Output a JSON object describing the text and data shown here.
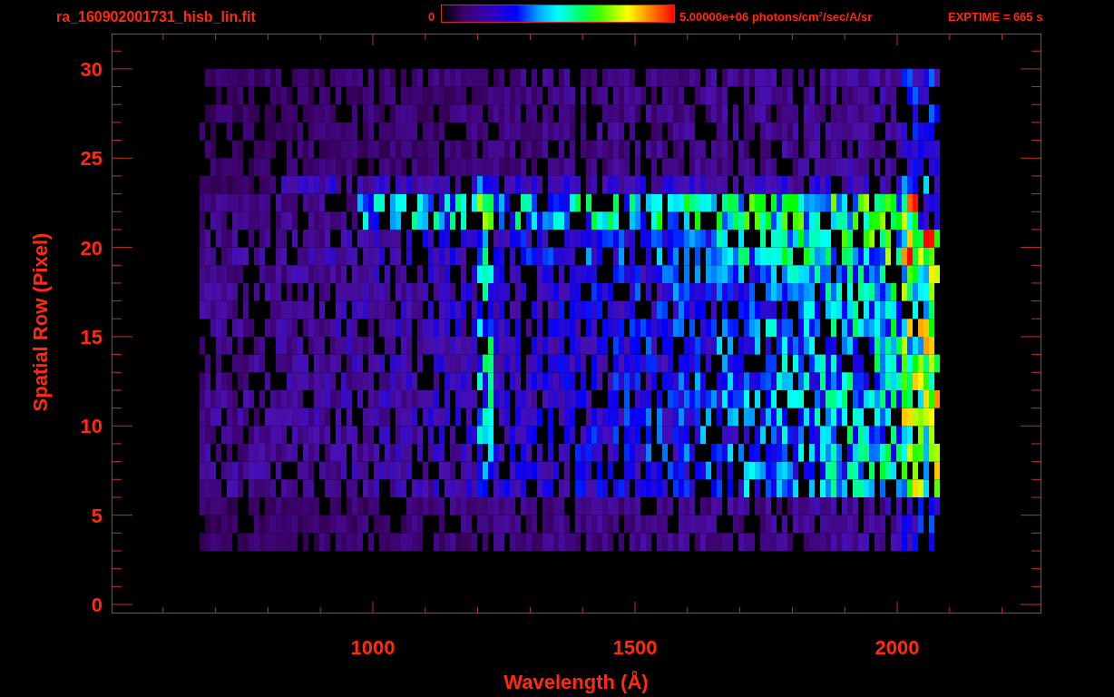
{
  "header": {
    "filename": "ra_160902001731_hisb_lin.fit",
    "colorbar_min": "0",
    "colorbar_max": "5.00000e+06 photons/cm$^{2}$/sec/A/sr",
    "exptime": "EXPTIME = 665 s"
  },
  "plot": {
    "x_axis": {
      "title": "Wavelength (Å)",
      "tick_labels": [
        "1000",
        "1500",
        "2000"
      ]
    },
    "y_axis": {
      "title": "Spatial Row (Pixel)",
      "tick_labels": [
        "30",
        "25",
        "20",
        "15",
        "10",
        "5",
        "0"
      ]
    }
  }
}
